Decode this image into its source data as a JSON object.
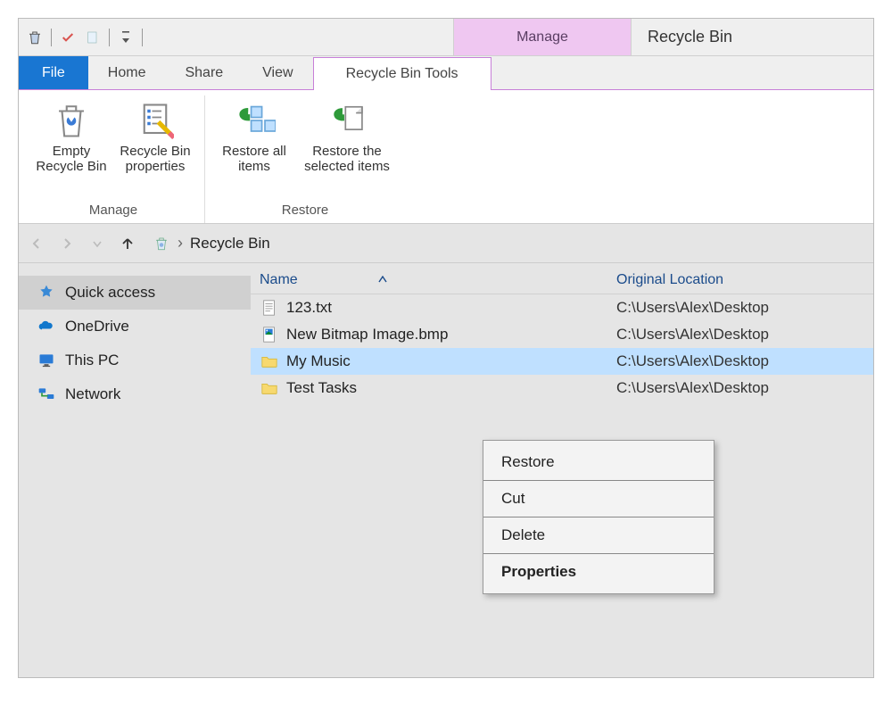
{
  "title": "Recycle Bin",
  "contextual_header": "Manage",
  "tabs": {
    "file": "File",
    "home": "Home",
    "share": "Share",
    "view": "View",
    "recycle": "Recycle Bin Tools"
  },
  "ribbon": {
    "manage": {
      "label": "Manage",
      "empty": "Empty Recycle Bin",
      "props": "Recycle Bin properties"
    },
    "restore": {
      "label": "Restore",
      "all": "Restore all items",
      "selected": "Restore the selected items"
    }
  },
  "breadcrumb": {
    "sep": "›",
    "location": "Recycle Bin"
  },
  "sidebar": {
    "quick_access": "Quick access",
    "onedrive": "OneDrive",
    "this_pc": "This PC",
    "network": "Network"
  },
  "columns": {
    "name": "Name",
    "location": "Original Location"
  },
  "files": [
    {
      "name": "123.txt",
      "location": "C:\\Users\\Alex\\Desktop",
      "type": "txt",
      "selected": false
    },
    {
      "name": "New Bitmap Image.bmp",
      "location": "C:\\Users\\Alex\\Desktop",
      "type": "bmp",
      "selected": false
    },
    {
      "name": "My Music",
      "location": "C:\\Users\\Alex\\Desktop",
      "type": "folder",
      "selected": true
    },
    {
      "name": "Test Tasks",
      "location": "C:\\Users\\Alex\\Desktop",
      "type": "folder",
      "selected": false
    }
  ],
  "context_menu": {
    "restore": "Restore",
    "cut": "Cut",
    "delete": "Delete",
    "properties": "Properties"
  }
}
